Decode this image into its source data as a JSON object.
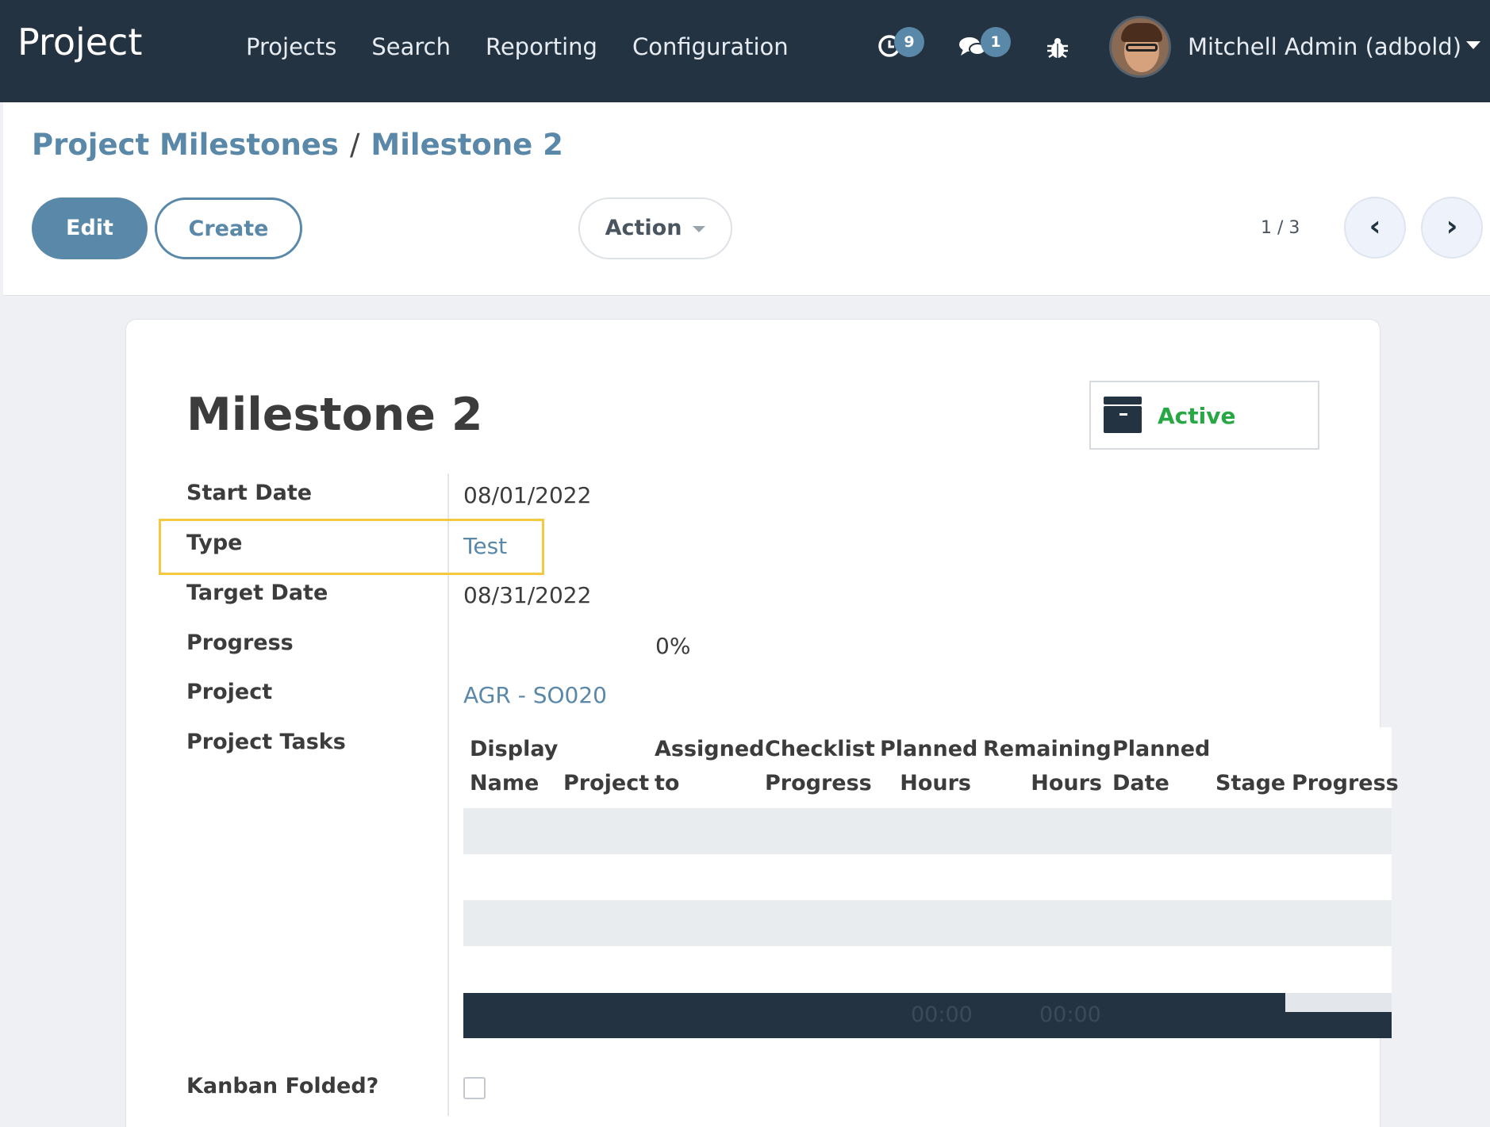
{
  "app": {
    "title": "Project"
  },
  "menu": [
    "Projects",
    "Search",
    "Reporting",
    "Configuration"
  ],
  "systray": {
    "activity_badge": "9",
    "messages_badge": "1",
    "user_name": "Mitchell Admin (adbold)"
  },
  "breadcrumb": {
    "parent": "Project Milestones",
    "separator": "/",
    "current": "Milestone 2"
  },
  "buttons": {
    "edit": "Edit",
    "create": "Create",
    "action": "Action",
    "prev": "‹",
    "next": "›"
  },
  "pager": {
    "value": "1 / 3"
  },
  "record": {
    "title": "Milestone 2",
    "status": "Active",
    "fields": {
      "start_date": {
        "label": "Start Date",
        "value": "08/01/2022"
      },
      "type": {
        "label": "Type",
        "value": "Test"
      },
      "target_date": {
        "label": "Target Date",
        "value": "08/31/2022"
      },
      "progress": {
        "label": "Progress",
        "value": "0%"
      },
      "project": {
        "label": "Project",
        "value": "AGR - SO020"
      },
      "project_tasks": {
        "label": "Project Tasks"
      },
      "kanban_folded": {
        "label": "Kanban Folded?",
        "value": false
      }
    }
  },
  "tasks_table": {
    "columns": [
      {
        "line1": "Display",
        "line2": "Name"
      },
      {
        "line1": "",
        "line2": "Project"
      },
      {
        "line1": "Assigned",
        "line2": "to"
      },
      {
        "line1": "Checklist",
        "line2": "Progress"
      },
      {
        "line1": "Planned",
        "line2": "Hours"
      },
      {
        "line1": "Remaining",
        "line2": "Hours"
      },
      {
        "line1": "Planned",
        "line2": "Date"
      },
      {
        "line1": "",
        "line2": "Stage"
      },
      {
        "line1": "",
        "line2": "Progress"
      }
    ],
    "footer": {
      "planned_hours": "00:00",
      "remaining_hours": "00:00"
    }
  },
  "colors": {
    "navbar": "#243342",
    "accent": "#5a88a8",
    "active": "#28a745",
    "highlight": "#f5c842"
  }
}
